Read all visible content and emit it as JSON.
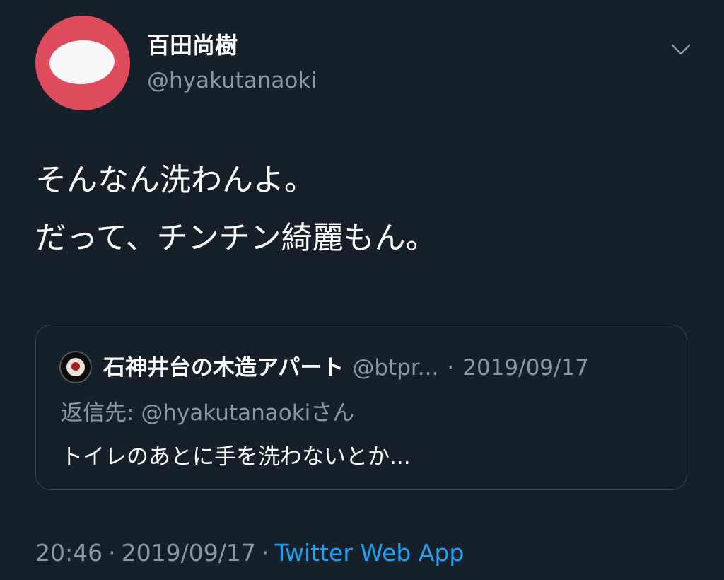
{
  "author": {
    "display_name": "百田尚樹",
    "handle": "@hyakutanaoki",
    "avatar_icon": "avatar-image",
    "avatar_color": "#de4b5c"
  },
  "menu": {
    "icon": "chevron-down-icon"
  },
  "tweet": {
    "lines": [
      "そんなん洗わんよ。",
      "だって、チンチン綺麗もん。"
    ]
  },
  "quote": {
    "name": "石神井台の木造アパート",
    "handle": "@btpr...",
    "separator": "·",
    "date": "2019/09/17",
    "reply_prefix": "返信先: ",
    "reply_handle": "@hyakutanaoki",
    "reply_suffix": "さん",
    "text": "トイレのあとに手を洗わないとか..."
  },
  "footer": {
    "time": "20:46",
    "separator": "·",
    "date": "2019/09/17",
    "source": "Twitter Web App"
  },
  "colors": {
    "background": "#15202b",
    "secondary_text": "#8899a6",
    "link": "#1da1f2",
    "border": "#38444d"
  }
}
